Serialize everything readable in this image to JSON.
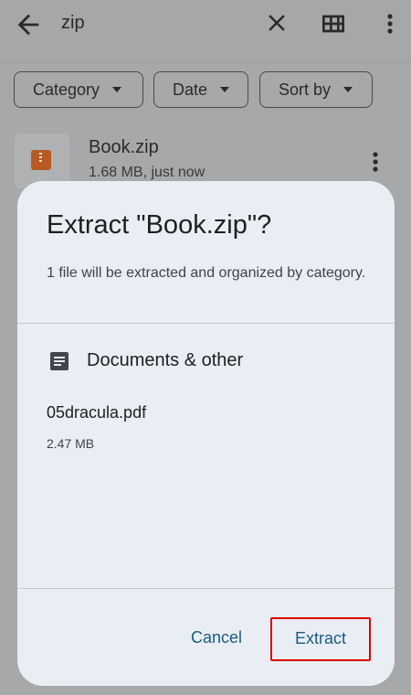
{
  "topbar": {
    "query": "zip",
    "back_icon": "arrow-left-icon",
    "close_icon": "close-icon",
    "grid_icon": "grid-view-icon",
    "more_icon": "more-vert-icon"
  },
  "filters": [
    {
      "label": "Category"
    },
    {
      "label": "Date"
    },
    {
      "label": "Sort by"
    }
  ],
  "file": {
    "name": "Book.zip",
    "meta": "1.68 MB, just now",
    "icon": "zip-file-icon"
  },
  "dialog": {
    "title": "Extract \"Book.zip\"?",
    "description": "1 file will be extracted and organized by category.",
    "section_title": "Documents & other",
    "section_icon": "document-icon",
    "item_name": "05dracula.pdf",
    "item_size": "2.47 MB",
    "cancel_label": "Cancel",
    "extract_label": "Extract"
  },
  "colors": {
    "scrim": "#a7a8a9",
    "dialog_bg": "#e8eef4",
    "accent": "#1b5c7e",
    "highlight": "#e00000",
    "zip_icon": "#b85a22"
  }
}
